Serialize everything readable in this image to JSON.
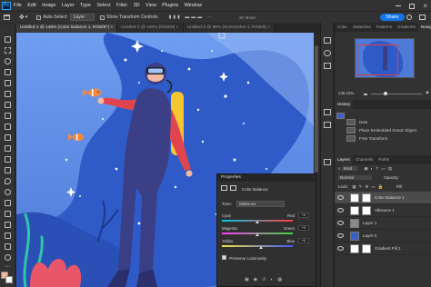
{
  "menubar": {
    "app_icon": "Ps",
    "items": [
      "File",
      "Edit",
      "Image",
      "Layer",
      "Type",
      "Select",
      "Filter",
      "3D",
      "View",
      "Plugins",
      "Window"
    ]
  },
  "options": {
    "auto_select_label": "Auto-Select:",
    "auto_select_value": "Layer",
    "show_transform_label": "Show Transform Controls",
    "share_label": "Share"
  },
  "tabs": [
    {
      "label": "Untitled-1 @ 146% (Color Balance 1, RGB/8*)",
      "active": true
    },
    {
      "label": "Untitled-3 @ 100% (RGB/8)",
      "active": false
    },
    {
      "label": "Untitled-3 @ 88% (Screenshot 1, RGB/8)",
      "active": false
    }
  ],
  "properties": {
    "title": "Properties",
    "adjustment_name": "Color Balance",
    "tone_label": "Tone:",
    "tone_value": "Midtones",
    "sliders": [
      {
        "left": "Cyan",
        "right": "Red",
        "value": "+0",
        "position": 0.5
      },
      {
        "left": "Magenta",
        "right": "Green",
        "value": "+0",
        "position": 0.5
      },
      {
        "left": "Yellow",
        "right": "Blue",
        "value": "+0",
        "position": 0.55
      }
    ],
    "preserve_label": "Preserve Luminosity"
  },
  "navigator": {
    "tabs": [
      "Color",
      "Swatches",
      "Patterns",
      "Gradients",
      "Navigator"
    ],
    "active_tab": "Navigator",
    "zoom": "146.41%"
  },
  "history": {
    "title": "History",
    "items": [
      "New",
      "Place Embedded Smart Object",
      "Free Transform"
    ]
  },
  "layers_panel": {
    "tabs": [
      "Layers",
      "Channels",
      "Paths"
    ],
    "kind_label": "Kind",
    "blend_mode": "Normal",
    "opacity_label": "Opacity:",
    "lock_label": "Lock:",
    "fill_label": "Fill:",
    "layers": [
      {
        "name": "Color Balance 1",
        "selected": true,
        "thumb_color": "#ffffff"
      },
      {
        "name": "Vibrance 1",
        "selected": false,
        "thumb_color": "#ffffff"
      },
      {
        "name": "Layer 1",
        "selected": false,
        "thumb_color": "#8a8a8a"
      },
      {
        "name": "Layer 0",
        "selected": false,
        "thumb_color": "#3b60c4"
      },
      {
        "name": "Gradient Fill 1",
        "selected": false,
        "thumb_color": "#ffffff"
      }
    ]
  },
  "colors": {
    "accent": "#1473e6",
    "canvas_bg": "#5f8fe0",
    "shape_blue": "#2e58c9",
    "suit": "#3b3f86",
    "coral": "#e8566a"
  }
}
